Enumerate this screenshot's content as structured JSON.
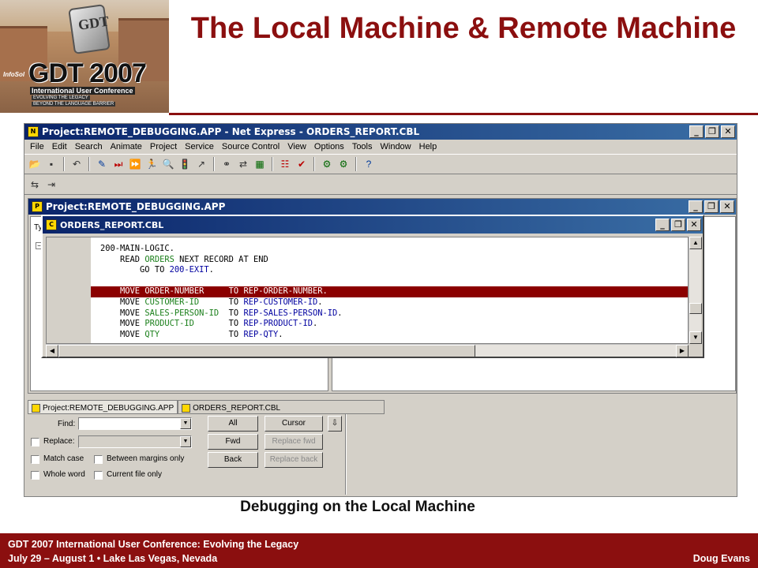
{
  "header": {
    "logo": {
      "emblem_text": "GDT",
      "main": "GDT 2007",
      "line1": "International User Conference",
      "line2": "EVOLVING THE LEGACY",
      "line3": "BEYOND THE LANGUAGE BARRIER",
      "brand": "InfoSol"
    },
    "title": "The Local Machine & Remote Machine"
  },
  "app": {
    "title": "Project:REMOTE_DEBUGGING.APP - Net Express - ORDERS_REPORT.CBL",
    "menu": [
      "File",
      "Edit",
      "Search",
      "Animate",
      "Project",
      "Service",
      "Source Control",
      "View",
      "Options",
      "Tools",
      "Window",
      "Help"
    ],
    "project_window": {
      "title": "Project:REMOTE_DEBUGGING.APP",
      "left_pane_text": "Ty"
    },
    "code_window": {
      "title": "ORDERS_REPORT.CBL",
      "lines": [
        {
          "seg": [
            "200-MAIN-LOGIC."
          ],
          "cls": [
            "c1"
          ],
          "indent": "",
          "highlight": false
        },
        {
          "seg": [
            "READ ",
            "ORDERS",
            " NEXT RECORD AT END"
          ],
          "cls": [
            "c1",
            "c2",
            "c1"
          ],
          "indent": "    ",
          "highlight": false
        },
        {
          "seg": [
            "GO TO ",
            "200-EXIT",
            "."
          ],
          "cls": [
            "c1",
            "c3",
            "c1"
          ],
          "indent": "        ",
          "highlight": false
        },
        {
          "seg": [
            ""
          ],
          "cls": [
            "c1"
          ],
          "indent": "",
          "highlight": false
        },
        {
          "seg": [
            "MOVE ",
            "ORDER-NUMBER",
            "     TO ",
            "REP-ORDER-NUMBER",
            "."
          ],
          "cls": [
            "c1",
            "c2",
            "c1",
            "c3",
            "c1"
          ],
          "indent": "    ",
          "highlight": true
        },
        {
          "seg": [
            "MOVE ",
            "CUSTOMER-ID",
            "      TO ",
            "REP-CUSTOMER-ID",
            "."
          ],
          "cls": [
            "c1",
            "c2",
            "c1",
            "c3",
            "c1"
          ],
          "indent": "    ",
          "highlight": false
        },
        {
          "seg": [
            "MOVE ",
            "SALES-PERSON-ID",
            "  TO ",
            "REP-SALES-PERSON-ID",
            "."
          ],
          "cls": [
            "c1",
            "c2",
            "c1",
            "c3",
            "c1"
          ],
          "indent": "    ",
          "highlight": false
        },
        {
          "seg": [
            "MOVE ",
            "PRODUCT-ID",
            "       TO ",
            "REP-PRODUCT-ID",
            "."
          ],
          "cls": [
            "c1",
            "c2",
            "c1",
            "c3",
            "c1"
          ],
          "indent": "    ",
          "highlight": false
        },
        {
          "seg": [
            "MOVE ",
            "QTY",
            "              TO ",
            "REP-QTY",
            "."
          ],
          "cls": [
            "c1",
            "c2",
            "c1",
            "c3",
            "c1"
          ],
          "indent": "    ",
          "highlight": false
        }
      ]
    },
    "tabs": [
      "Project:REMOTE_DEBUGGING.APP",
      "ORDERS_REPORT.CBL"
    ],
    "find_panel": {
      "find_label": "Find:",
      "replace_label": "Replace:",
      "match_case": "Match case",
      "between_margins": "Between margins only",
      "whole_word": "Whole word",
      "current_file": "Current file only",
      "all": "All",
      "cursor": "Cursor",
      "fwd": "Fwd",
      "back": "Back",
      "replace_fwd": "Replace fwd",
      "replace_back": "Replace back"
    }
  },
  "caption": "Debugging on the Local Machine",
  "footer": {
    "line1": "GDT 2007 International User Conference: Evolving the Legacy",
    "line2": "July 29 – August 1  •  Lake Las Vegas, Nevada",
    "author": "Doug Evans"
  },
  "colors": {
    "brand_red": "#8b0f0f",
    "titlebar_blue": "#0a246a",
    "highlight_line": "#8b0000"
  }
}
